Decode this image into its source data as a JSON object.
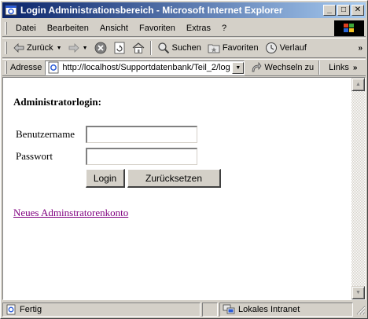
{
  "window": {
    "title": "Login Administrationsbereich - Microsoft Internet Explorer",
    "minimize_glyph": "_",
    "maximize_glyph": "□",
    "close_glyph": "✕"
  },
  "menubar": {
    "items": [
      "Datei",
      "Bearbeiten",
      "Ansicht",
      "Favoriten",
      "Extras",
      "?"
    ]
  },
  "toolbar": {
    "back_label": "Zurück",
    "search_label": "Suchen",
    "favorites_label": "Favoriten",
    "history_label": "Verlauf",
    "more_glyph": "»"
  },
  "addressbar": {
    "label": "Adresse",
    "url": "http://localhost/Supportdatenbank/Teil_2/log",
    "go_label": "Wechseln zu",
    "links_label": "Links",
    "more_glyph": "»"
  },
  "page": {
    "heading": "Administratorlogin:",
    "username_label": "Benutzername",
    "username_value": "",
    "password_label": "Passwort",
    "password_value": "",
    "login_button": "Login",
    "reset_button": "Zurücksetzen",
    "new_account_link": "Neues Adminstratorenkonto"
  },
  "statusbar": {
    "status_text": "Fertig",
    "zone_text": "Lokales Intranet"
  },
  "colors": {
    "titlebar_start": "#0a246a",
    "titlebar_end": "#a6caf0",
    "chrome": "#d4d0c8",
    "visited_link": "#800080"
  }
}
